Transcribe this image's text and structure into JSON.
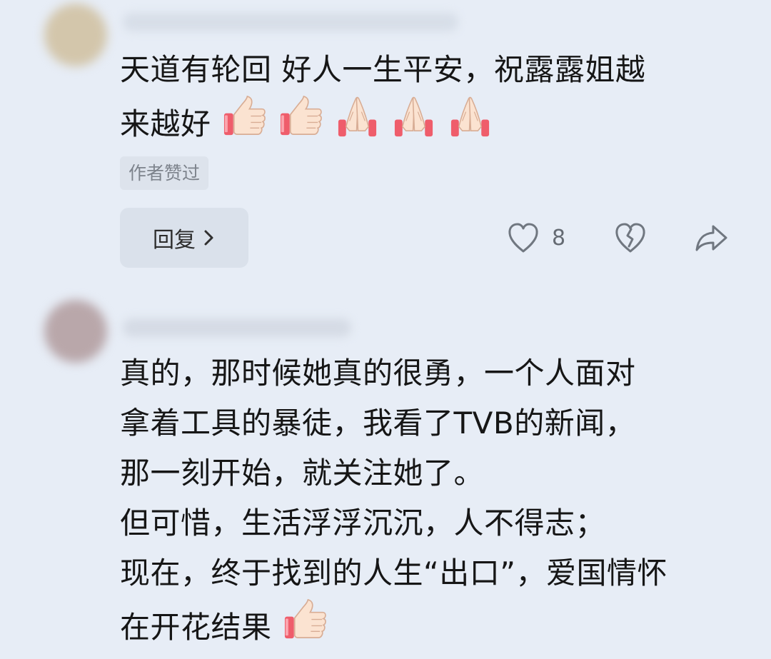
{
  "comments": [
    {
      "text_lines": [
        "天道有轮回 好人一生平安，祝露露姐越",
        "来越好"
      ],
      "emojis": [
        "thumbs-up",
        "thumbs-up",
        "folded-hands",
        "folded-hands",
        "folded-hands"
      ],
      "author_liked_badge": "作者赞过",
      "reply_label": "回复",
      "like_count": "8"
    },
    {
      "text_lines": [
        "真的，那时候她真的很勇，一个人面对",
        "拿着工具的暴徒，我看了TVB的新闻，",
        "那一刻开始，就关注她了。",
        "但可惜，生活浮浮沉沉，人不得志；",
        "现在，终于找到的人生“出口”，爱国情怀",
        "在开花结果"
      ],
      "emojis": [
        "thumbs-up"
      ]
    }
  ],
  "icons": {
    "like": "heart-outline-icon",
    "dislike": "broken-heart-icon",
    "share": "share-arrow-icon",
    "reply_chevron": "chevron-right-icon",
    "thumbs_up": "thumbs-up-emoji-icon",
    "folded_hands": "folded-hands-emoji-icon"
  },
  "colors": {
    "background": "#e7edf6",
    "badge_background": "#dde3ec",
    "reply_button_background": "#dae1eb",
    "muted_icon": "#707780"
  }
}
